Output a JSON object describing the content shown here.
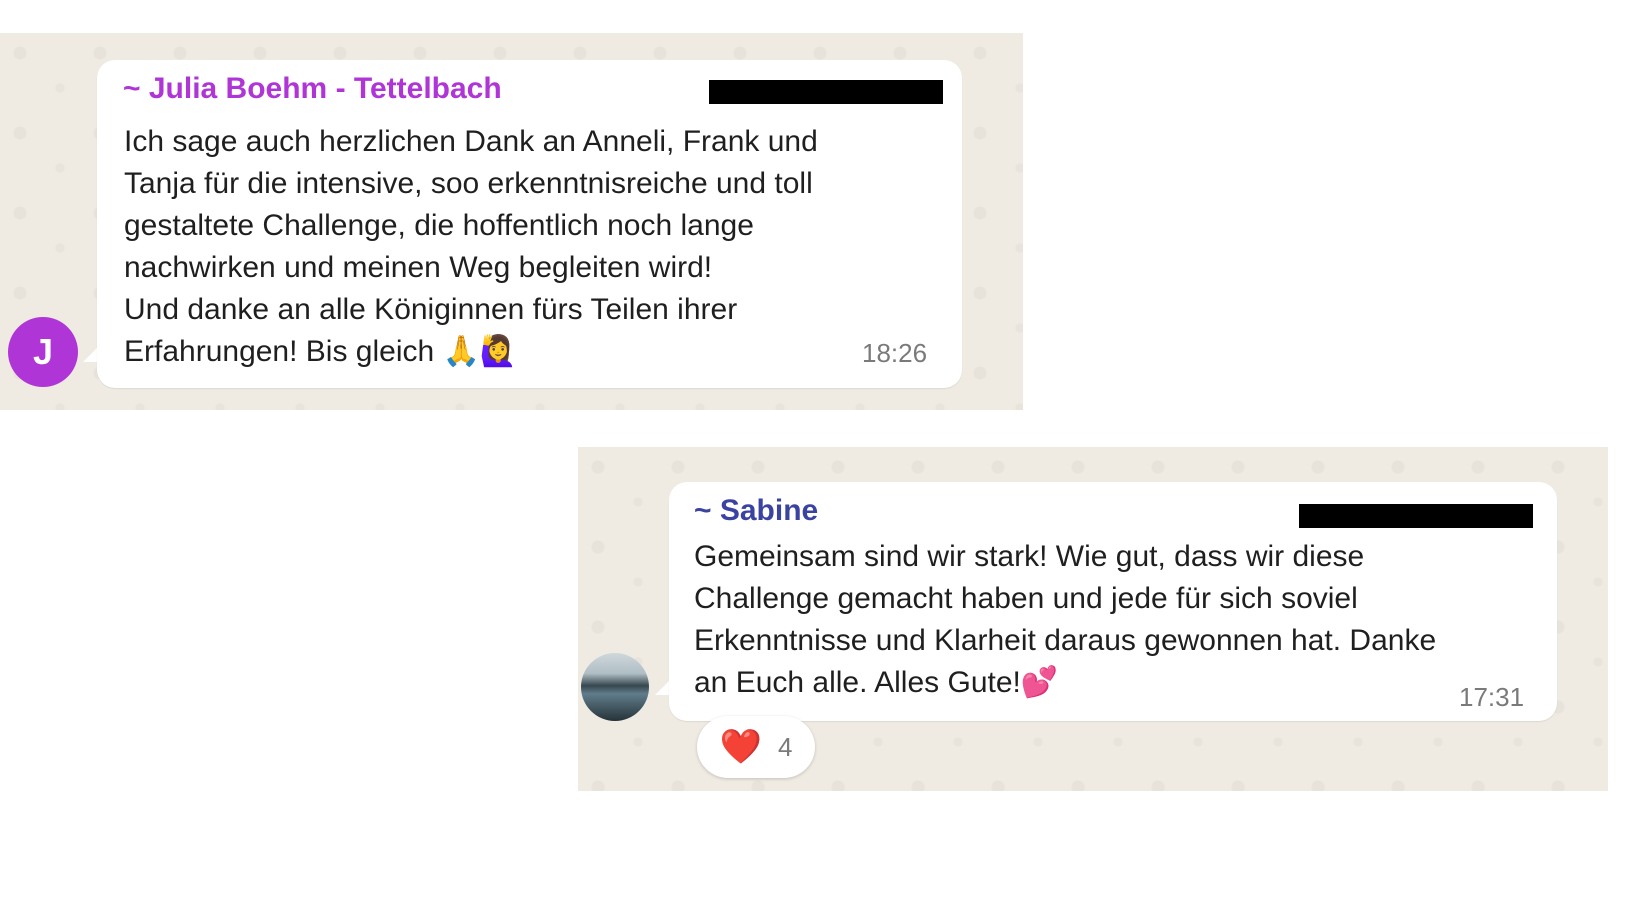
{
  "messages": [
    {
      "sender": "~ Julia Boehm - Tettelbach",
      "avatar_initial": "J",
      "text_lines": [
        "Ich sage auch herzlichen Dank an Anneli, Frank und",
        "Tanja für die intensive, soo erkenntnisreiche und toll",
        "gestaltete Challenge, die hoffentlich noch lange",
        "nachwirken und meinen Weg begleiten wird!",
        "Und danke an alle Königinnen fürs Teilen ihrer",
        "Erfahrungen! Bis gleich 🙏🙋‍♀️"
      ],
      "time": "18:26",
      "sender_color": "#b035d6"
    },
    {
      "sender": "~ Sabine",
      "text_lines": [
        "Gemeinsam sind wir stark! Wie gut, dass wir diese",
        "Challenge gemacht haben und jede für sich soviel",
        "Erkenntnisse und Klarheit daraus gewonnen hat. Danke",
        "an Euch alle. Alles Gute!💕"
      ],
      "time": "17:31",
      "sender_color": "#3b43a1",
      "reaction": {
        "emoji": "❤️",
        "count": "4"
      }
    }
  ]
}
